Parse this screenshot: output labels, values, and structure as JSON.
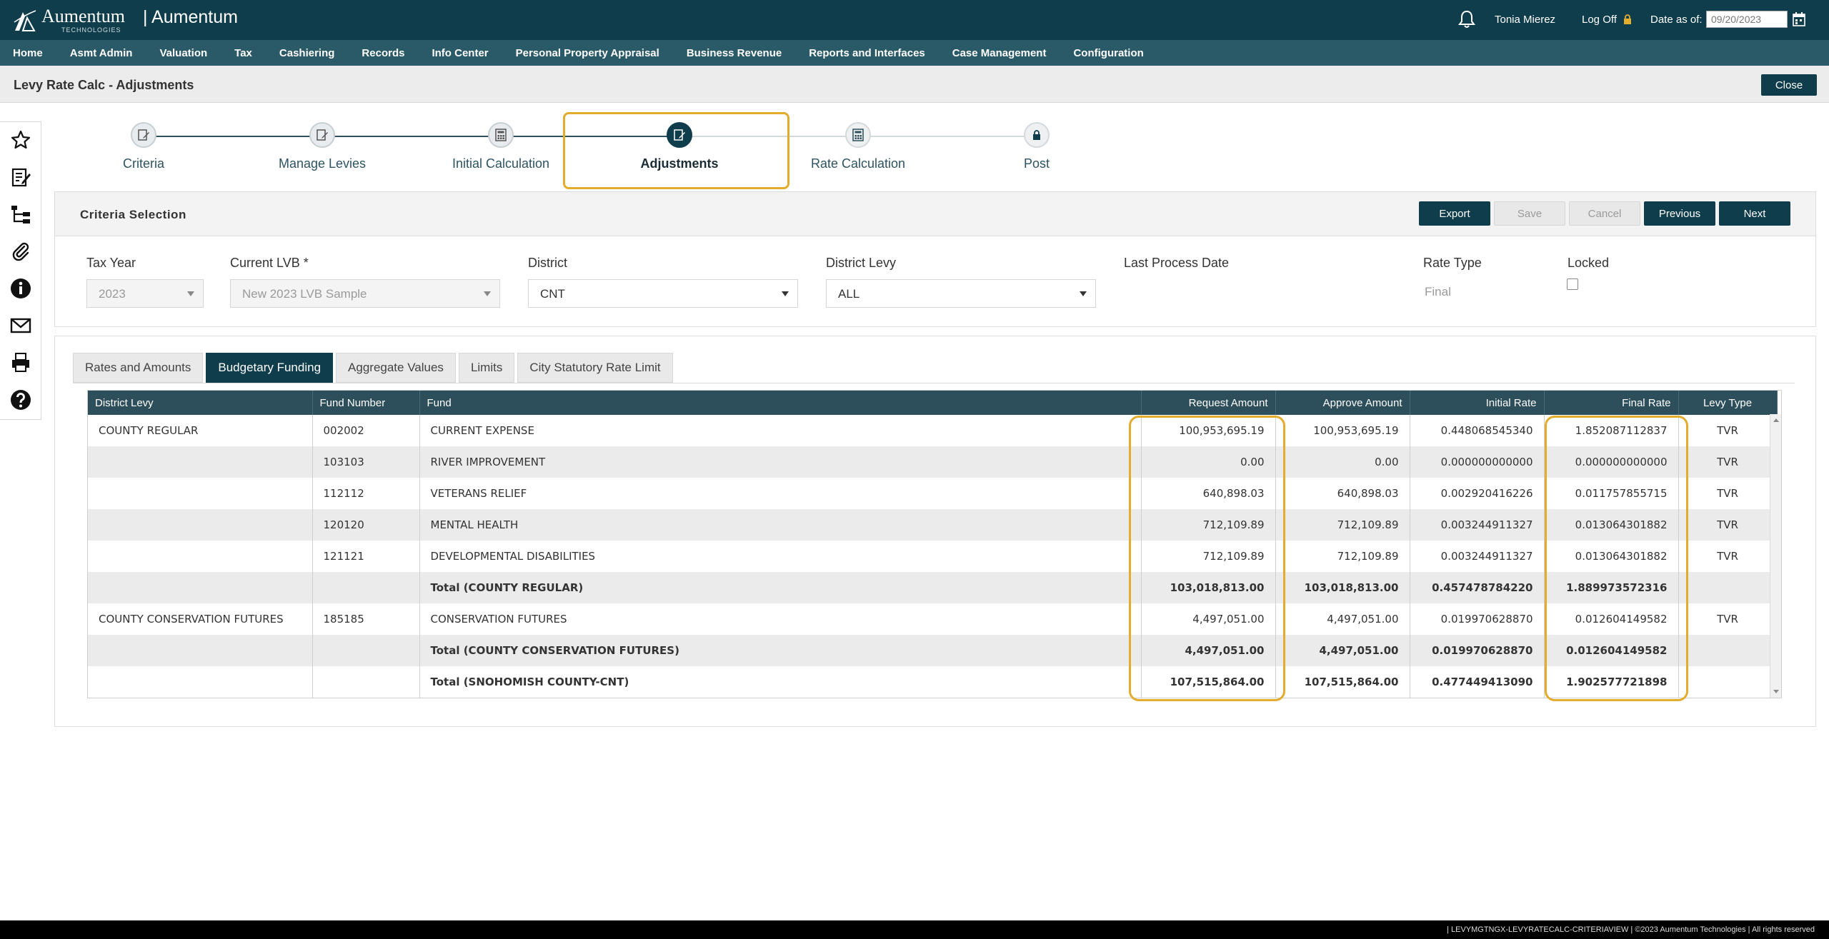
{
  "header": {
    "logo_text": "Aumentum",
    "logo_sub": "TECHNOLOGIES",
    "app_name": "| Aumentum",
    "user_name": "Tonia Mierez",
    "logoff_label": "Log Off",
    "date_label": "Date as of:",
    "date_value": "09/20/2023"
  },
  "nav": {
    "items": [
      "Home",
      "Asmt Admin",
      "Valuation",
      "Tax",
      "Cashiering",
      "Records",
      "Info Center",
      "Personal Property Appraisal",
      "Business Revenue",
      "Reports and Interfaces",
      "Case Management",
      "Configuration"
    ]
  },
  "page": {
    "title": "Levy Rate Calc - Adjustments",
    "close_label": "Close"
  },
  "left_toolbar": {
    "icons": [
      "star-icon",
      "edit-doc-icon",
      "hierarchy-icon",
      "paperclip-icon",
      "info-icon",
      "mail-icon",
      "printer-icon",
      "help-icon"
    ]
  },
  "stepper": {
    "steps": [
      {
        "label": "Criteria",
        "state": "done"
      },
      {
        "label": "Manage Levies",
        "state": "done"
      },
      {
        "label": "Initial Calculation",
        "state": "done"
      },
      {
        "label": "Adjustments",
        "state": "active"
      },
      {
        "label": "Rate Calculation",
        "state": "pending"
      },
      {
        "label": "Post",
        "state": "pending"
      }
    ]
  },
  "criteria": {
    "title": "Criteria Selection",
    "buttons": {
      "export": "Export",
      "save": "Save",
      "cancel": "Cancel",
      "previous": "Previous",
      "next": "Next"
    },
    "fields": {
      "tax_year": {
        "label": "Tax Year",
        "value": "2023"
      },
      "current_lvb": {
        "label": "Current LVB *",
        "value": "New 2023 LVB Sample"
      },
      "district": {
        "label": "District",
        "value": "CNT"
      },
      "district_levy": {
        "label": "District Levy",
        "value": "ALL"
      },
      "last_process_date": {
        "label": "Last Process Date",
        "value": ""
      },
      "rate_type": {
        "label": "Rate Type",
        "value": "Final"
      },
      "locked": {
        "label": "Locked",
        "checked": false
      }
    }
  },
  "tabs": [
    "Rates and Amounts",
    "Budgetary Funding",
    "Aggregate Values",
    "Limits",
    "City Statutory Rate Limit"
  ],
  "active_tab": "Budgetary Funding",
  "table": {
    "columns": [
      "District Levy",
      "Fund Number",
      "Fund",
      "Request Amount",
      "Approve Amount",
      "Initial Rate",
      "Final Rate",
      "Levy Type"
    ],
    "rows": [
      {
        "district_levy": "COUNTY REGULAR",
        "fund_number": "002002",
        "fund": "CURRENT EXPENSE",
        "request": "100,953,695.19",
        "approve": "100,953,695.19",
        "initial": "0.448068545340",
        "final": "1.852087112837",
        "levy_type": "TVR",
        "total": false
      },
      {
        "district_levy": "",
        "fund_number": "103103",
        "fund": "RIVER IMPROVEMENT",
        "request": "0.00",
        "approve": "0.00",
        "initial": "0.000000000000",
        "final": "0.000000000000",
        "levy_type": "TVR",
        "total": false
      },
      {
        "district_levy": "",
        "fund_number": "112112",
        "fund": "VETERANS RELIEF",
        "request": "640,898.03",
        "approve": "640,898.03",
        "initial": "0.002920416226",
        "final": "0.011757855715",
        "levy_type": "TVR",
        "total": false
      },
      {
        "district_levy": "",
        "fund_number": "120120",
        "fund": "MENTAL HEALTH",
        "request": "712,109.89",
        "approve": "712,109.89",
        "initial": "0.003244911327",
        "final": "0.013064301882",
        "levy_type": "TVR",
        "total": false
      },
      {
        "district_levy": "",
        "fund_number": "121121",
        "fund": "DEVELOPMENTAL DISABILITIES",
        "request": "712,109.89",
        "approve": "712,109.89",
        "initial": "0.003244911327",
        "final": "0.013064301882",
        "levy_type": "TVR",
        "total": false
      },
      {
        "district_levy": "",
        "fund_number": "",
        "fund": "Total (COUNTY REGULAR)",
        "request": "103,018,813.00",
        "approve": "103,018,813.00",
        "initial": "0.457478784220",
        "final": "1.889973572316",
        "levy_type": "",
        "total": true
      },
      {
        "district_levy": "COUNTY CONSERVATION FUTURES",
        "fund_number": "185185",
        "fund": "CONSERVATION FUTURES",
        "request": "4,497,051.00",
        "approve": "4,497,051.00",
        "initial": "0.019970628870",
        "final": "0.012604149582",
        "levy_type": "TVR",
        "total": false
      },
      {
        "district_levy": "",
        "fund_number": "",
        "fund": "Total (COUNTY CONSERVATION FUTURES)",
        "request": "4,497,051.00",
        "approve": "4,497,051.00",
        "initial": "0.019970628870",
        "final": "0.012604149582",
        "levy_type": "",
        "total": true
      },
      {
        "district_levy": "",
        "fund_number": "",
        "fund": "Total (SNOHOMISH COUNTY-CNT)",
        "request": "107,515,864.00",
        "approve": "107,515,864.00",
        "initial": "0.477449413090",
        "final": "1.902577721898",
        "levy_type": "",
        "total": true
      }
    ]
  },
  "footer": {
    "text": "|  LEVYMGTNGX-LEVYRATECALC-CRITERIAVIEW   |  ©2023 Aumentum Technologies | All rights reserved"
  },
  "colors": {
    "header_bg": "#0f3d4c",
    "nav_bg": "#2a5967",
    "table_header_bg": "#2d4f5c",
    "highlight": "#e4ac2d"
  }
}
